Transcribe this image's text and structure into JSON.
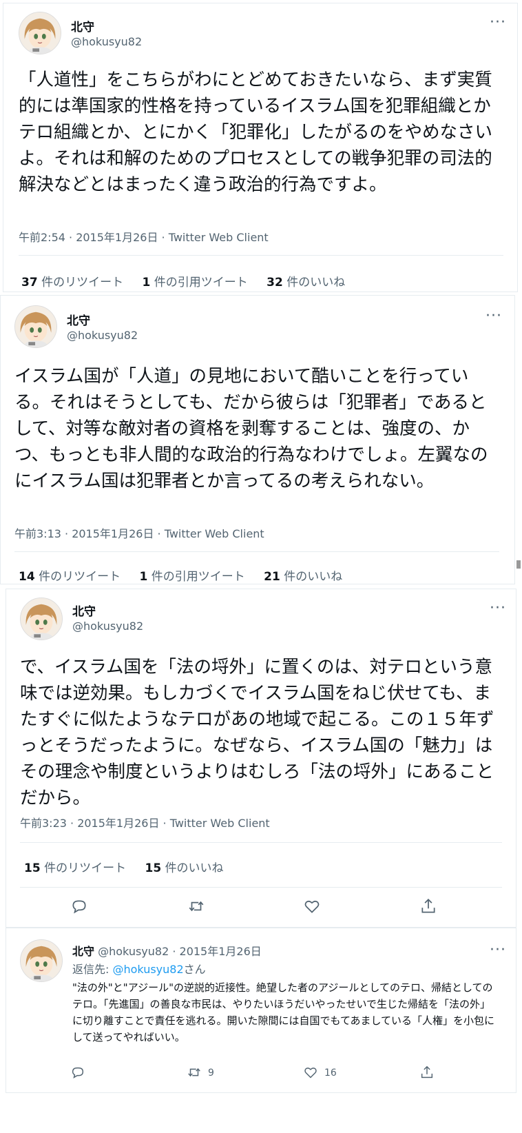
{
  "tweets": [
    {
      "name": "北守",
      "handle": "@hokusyu82",
      "more": "···",
      "text": "「人道性」をこちらがわにとどめておきたいなら、まず実質的には準国家的性格を持っているイスラム国を犯罪組織とかテロ組織とか、とにかく「犯罪化」したがるのをやめなさいよ。それは和解のためのプロセスとしての戦争犯罪の司法的解決などとはまったく違う政治的行為ですよ。",
      "meta": "午前2:54 · 2015年1月26日 · Twitter Web Client",
      "retweets_count": "37",
      "retweets_label": "件のリツイート",
      "quotes_count": "1",
      "quotes_label": "件の引用ツイート",
      "likes_count": "32",
      "likes_label": "件のいいね"
    },
    {
      "name": "北守",
      "handle": "@hokusyu82",
      "more": "···",
      "text": "イスラム国が「人道」の見地において酷いことを行っている。それはそうとしても、だから彼らは「犯罪者」であるとして、対等な敵対者の資格を剥奪することは、強度の、かつ、もっとも非人間的な政治的行為なわけでしょ。左翼なのにイスラム国は犯罪者とか言ってるの考えられない。",
      "meta": "午前3:13 · 2015年1月26日 · Twitter Web Client",
      "retweets_count": "14",
      "retweets_label": "件のリツイート",
      "quotes_count": "1",
      "quotes_label": "件の引用ツイート",
      "likes_count": "21",
      "likes_label": "件のいいね"
    },
    {
      "name": "北守",
      "handle": "@hokusyu82",
      "more": "···",
      "text": "で、イスラム国を「法の埒外」に置くのは、対テロという意味では逆効果。もしカづくでイスラム国をねじ伏せても、またすぐに似たようなテロがあの地域で起こる。この１５年ずっとそうだったように。なぜなら、イスラム国の「魅力」はその理念や制度というよりはむしろ「法の埒外」にあることだから。",
      "meta": "午前3:23 · 2015年1月26日 · Twitter Web Client",
      "retweets_count": "15",
      "retweets_label": "件のリツイート",
      "likes_count": "15",
      "likes_label": "件のいいね"
    }
  ],
  "reply": {
    "name": "北守",
    "handle_date": "@hokusyu82 · 2015年1月26日",
    "more": "···",
    "replyto_prefix": "返信先: ",
    "replyto_handle": "@hokusyu82",
    "replyto_suffix": "さん",
    "text": "\"法の外\"と\"アジール\"の逆説的近接性。絶望した者のアジールとしてのテロ、帰結としてのテロ。「先進国」の善良な市民は、やりたいほうだいやったせいで生じた帰結を「法の外」に切り離すことで責任を逃れる。開いた隙間には自国でもてあましている「人権」を小包にして送ってやればいい。",
    "retweet_count": "9",
    "like_count": "16"
  },
  "icons": [
    "reply-icon",
    "retweet-icon",
    "like-icon",
    "share-icon",
    "more-icon",
    "avatar"
  ],
  "colors": {
    "link": "#1d9bf0",
    "secondary": "#536471",
    "border": "#e6ecf0"
  }
}
